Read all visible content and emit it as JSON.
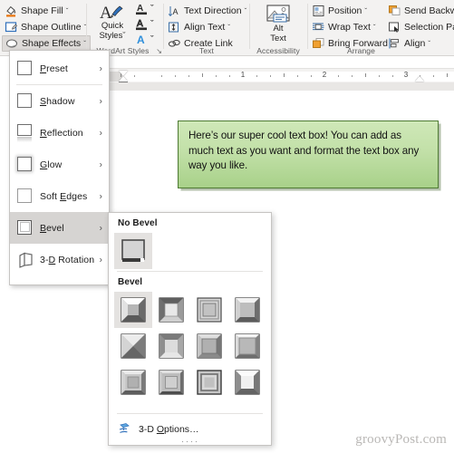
{
  "app": {
    "watermark": "groovyPost.com"
  },
  "ribbon": {
    "shape_styles": {
      "items": [
        {
          "label": "Shape Fill",
          "icon": "shape-fill-icon",
          "caret": "ˇ"
        },
        {
          "label": "Shape Outline",
          "icon": "shape-outline-icon",
          "caret": "ˇ"
        },
        {
          "label": "Shape Effects",
          "icon": "shape-effects-icon",
          "caret": "ˇ"
        }
      ]
    },
    "wordart_styles": {
      "label": "WordArt Styles",
      "quick_styles": {
        "line1": "Quick",
        "line2": "Styles",
        "caret": "ˇ"
      },
      "items": [
        {
          "icon": "text-fill-icon",
          "caret": "ˇ"
        },
        {
          "icon": "text-outline-icon",
          "caret": "ˇ"
        },
        {
          "icon": "text-effects-icon",
          "caret": "ˇ"
        }
      ],
      "dialog_launcher": "↘"
    },
    "text_group": {
      "label": "Text",
      "items": [
        {
          "label": "Text Direction",
          "icon": "text-direction-icon",
          "caret": "ˇ"
        },
        {
          "label": "Align Text",
          "icon": "align-text-icon",
          "caret": "ˇ"
        },
        {
          "label": "Create Link",
          "icon": "create-link-icon",
          "caret": ""
        }
      ]
    },
    "accessibility": {
      "label": "Accessibility",
      "alt_text": {
        "line1": "Alt",
        "line2": "Text",
        "icon": "alt-text-icon"
      }
    },
    "arrange": {
      "label": "Arrange",
      "items": [
        {
          "label": "Position",
          "icon": "position-icon",
          "caret": "ˇ"
        },
        {
          "label": "Wrap Text",
          "icon": "wrap-text-icon",
          "caret": "ˇ"
        },
        {
          "label": "Bring Forward",
          "icon": "bring-forward-icon",
          "caret": "ˇ"
        },
        {
          "label": "Send Backward",
          "icon": "send-backward-icon",
          "caret": "ˇ"
        },
        {
          "label": "Selection Pane",
          "icon": "selection-pane-icon",
          "caret": ""
        },
        {
          "label": "Align",
          "icon": "align-objects-icon",
          "caret": "ˇ"
        }
      ]
    }
  },
  "ruler": {
    "numbers": [
      "1",
      "2",
      "3"
    ]
  },
  "document": {
    "textbox": {
      "text": "Here’s our super cool text box! You can add as much text as you want and format the text box any way you like."
    }
  },
  "shape_effects_menu": {
    "items": [
      {
        "label_pre": "",
        "label_u": "P",
        "label_post": "reset",
        "icon": "preset-icon",
        "arrow": "›",
        "selected": false
      },
      {
        "label_pre": "",
        "label_u": "S",
        "label_post": "hadow",
        "icon": "shadow-icon",
        "arrow": "›",
        "selected": false
      },
      {
        "label_pre": "",
        "label_u": "R",
        "label_post": "eflection",
        "icon": "reflection-icon",
        "arrow": "›",
        "selected": false
      },
      {
        "label_pre": "",
        "label_u": "G",
        "label_post": "low",
        "icon": "glow-icon",
        "arrow": "›",
        "selected": false
      },
      {
        "label_pre": "Soft ",
        "label_u": "E",
        "label_post": "dges",
        "icon": "soft-edges-icon",
        "arrow": "›",
        "selected": false
      },
      {
        "label_pre": "",
        "label_u": "B",
        "label_post": "evel",
        "icon": "bevel-icon",
        "arrow": "›",
        "selected": true
      },
      {
        "label_pre": "3-",
        "label_u": "D",
        "label_post": " Rotation",
        "icon": "3d-rotation-icon",
        "arrow": "›",
        "selected": false
      }
    ]
  },
  "bevel_gallery": {
    "no_bevel_heading": "No Bevel",
    "bevel_heading": "Bevel",
    "no_bevel_items": [
      {
        "name": "no-bevel",
        "selected": true
      }
    ],
    "bevel_items": [
      {
        "name": "bevel-circle",
        "selected": true
      },
      {
        "name": "bevel-round",
        "selected": false
      },
      {
        "name": "bevel-slope",
        "selected": false
      },
      {
        "name": "bevel-cross",
        "selected": false
      },
      {
        "name": "bevel-angle",
        "selected": false
      },
      {
        "name": "bevel-soft-round",
        "selected": false
      },
      {
        "name": "bevel-convex",
        "selected": false
      },
      {
        "name": "bevel-cool-slant",
        "selected": false
      },
      {
        "name": "bevel-divot",
        "selected": false
      },
      {
        "name": "bevel-riblet",
        "selected": false
      },
      {
        "name": "bevel-hard-edge",
        "selected": false
      },
      {
        "name": "bevel-art-deco",
        "selected": false
      }
    ],
    "options": {
      "label_pre": "3-D ",
      "label_u": "O",
      "label_post": "ptions…",
      "icon": "3d-options-icon"
    }
  }
}
